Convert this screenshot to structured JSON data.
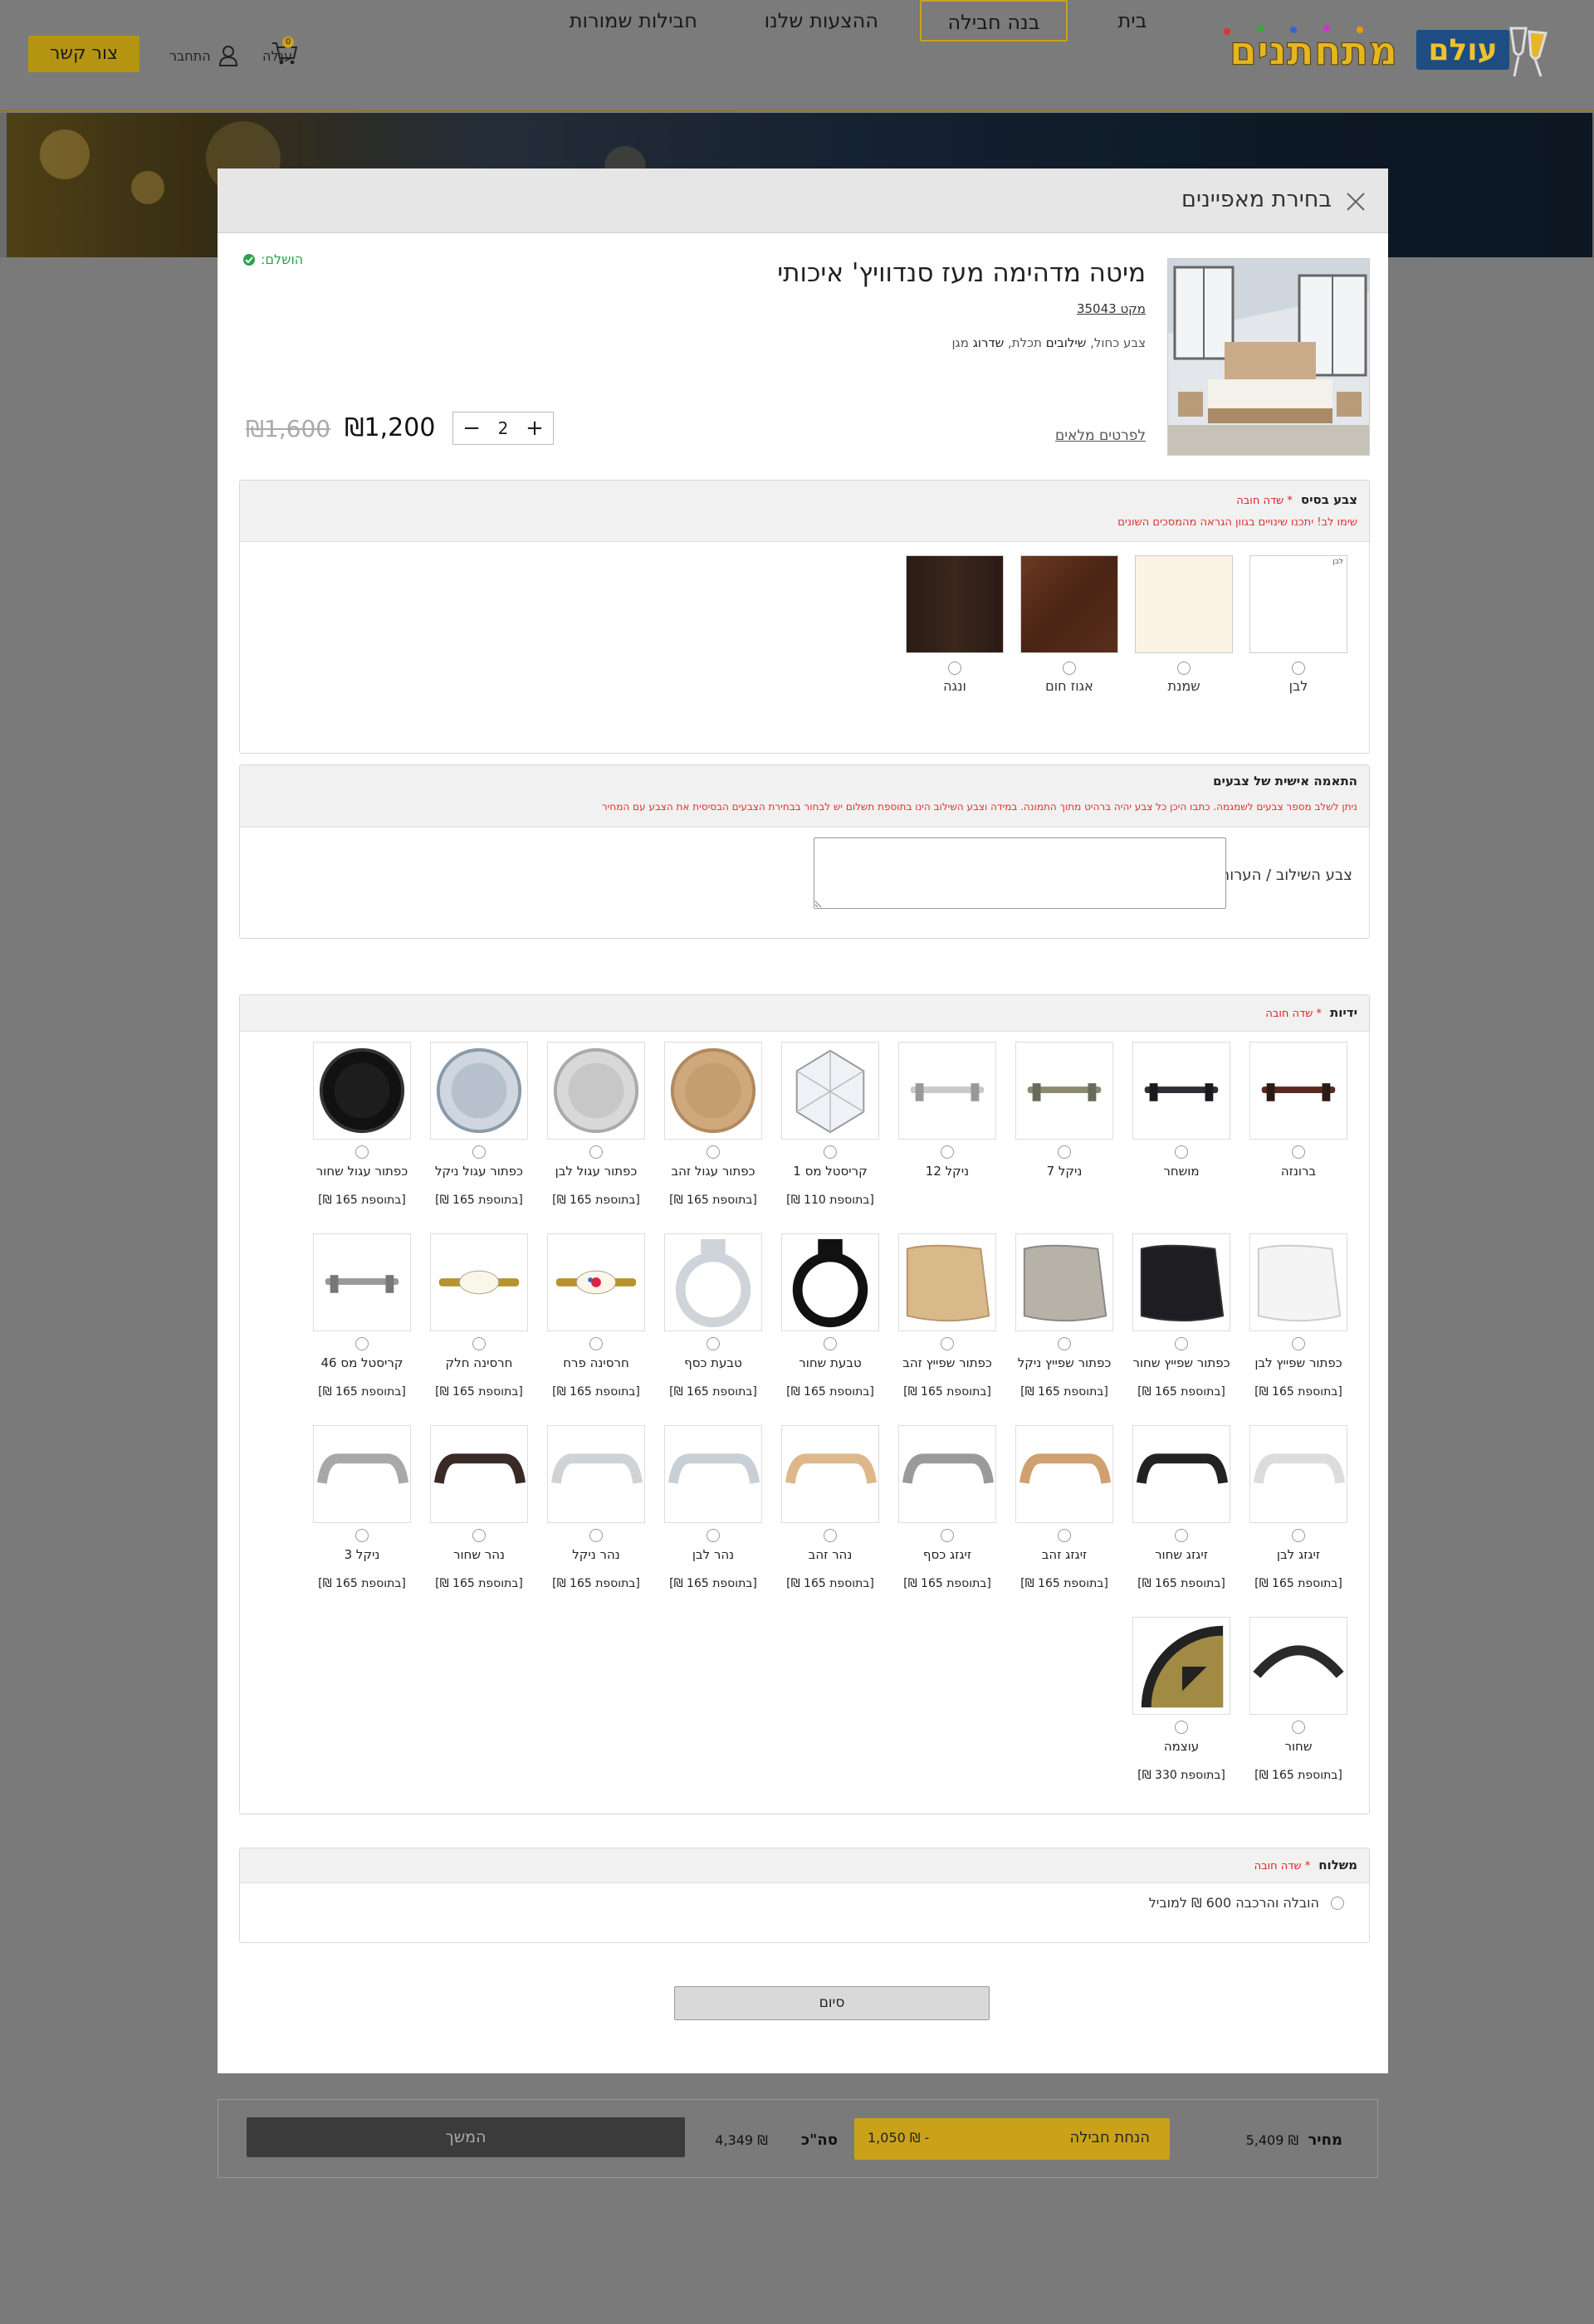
{
  "header": {
    "logo_text": "עולם מתחתנים",
    "nav": [
      "בית",
      "בנה חבילה",
      "ההצעות שלנו",
      "חבילות שמורות"
    ],
    "cart_label": "עגלה",
    "cart_count": "0",
    "login_label": "התחבר",
    "contact_button": "צור קשר"
  },
  "modal": {
    "title": "בחירת מאפיינים",
    "product": {
      "name": "מיטה מדהימה מעז סנדוויץ' איכותי",
      "sku": "מקט 35043",
      "attributes": {
        "prefix": "צבע",
        "items": [
          {
            "text": "כחול",
            "bold": false
          },
          {
            "text": "שילובים",
            "bold": true
          },
          {
            "text": "תכלת",
            "bold": false
          },
          {
            "text": "שדרוג",
            "bold": true
          },
          {
            "text": "מגן",
            "bold": false
          }
        ]
      },
      "completed_label": "הושלם:",
      "details_link": "לפרטים מלאים",
      "quantity": "2",
      "price": "₪1,200",
      "old_price": "₪1,600"
    },
    "base_color": {
      "title": "צבע בסיס",
      "required": "* שדה חובה",
      "note": "שימו לב! יתכנו שינויים בגוון הגראה מהמסכים השונים",
      "options": [
        {
          "name": "לבן",
          "color": "#ffffff",
          "tag": "לבן"
        },
        {
          "name": "שמנת",
          "color": "#fbf3e4"
        },
        {
          "name": "אגוז חום",
          "color": "#5a2e1c"
        },
        {
          "name": "ונגה",
          "color": "#2e1f18"
        }
      ]
    },
    "custom_colors": {
      "title": "התאמה אישית של צבעים",
      "note": "ניתן לשלב מספר צבעים לשמגמה. כתבו היכן כל צבע יהיה ברהיט מתוך התמונה.     במידה וצבע השילוב הינו בתוספת תשלום יש לבחור בבחירת הצבעים הבסיסית את הצבע עם המחיר",
      "field_label": "צבע השילוב / הערות"
    },
    "handles": {
      "title": "ידיות",
      "required": "* שדה חובה",
      "items": [
        {
          "name": "ברונזה",
          "addon": "",
          "icon": "bar-bronze"
        },
        {
          "name": "מושחר",
          "addon": "",
          "icon": "bar-dark"
        },
        {
          "name": "ניקל 7",
          "addon": "",
          "icon": "bar-nickel"
        },
        {
          "name": "ניקל 12",
          "addon": "",
          "icon": "bar-silver"
        },
        {
          "name": "קריסטל מס 1",
          "addon": "[בתוספת 110 ₪]",
          "icon": "crystal"
        },
        {
          "name": "כפתור עגול זהב",
          "addon": "[בתוספת 165 ₪]",
          "icon": "knob-gold"
        },
        {
          "name": "כפתור עגול לבן",
          "addon": "[בתוספת 165 ₪]",
          "icon": "knob-white"
        },
        {
          "name": "כפתור עגול ניקל",
          "addon": "[בתוספת 165 ₪]",
          "icon": "knob-nickel"
        },
        {
          "name": "כפתור עגול שחור",
          "addon": "[בתוספת 165 ₪]",
          "icon": "knob-black"
        },
        {
          "name": "כפתור שפייץ לבן",
          "addon": "[בתוספת 165 ₪]",
          "icon": "cone-white"
        },
        {
          "name": "כפתור שפייץ שחור",
          "addon": "[בתוספת 165 ₪]",
          "icon": "cone-black"
        },
        {
          "name": "כפתור שפייץ ניקל",
          "addon": "[בתוספת 165 ₪]",
          "icon": "cone-nickel"
        },
        {
          "name": "כפתור שפייץ זהב",
          "addon": "[בתוספת 165 ₪]",
          "icon": "cone-gold"
        },
        {
          "name": "טבעת שחור",
          "addon": "[בתוספת 165 ₪]",
          "icon": "ring-black"
        },
        {
          "name": "טבעת כסף",
          "addon": "[בתוספת 165 ₪]",
          "icon": "ring-silver"
        },
        {
          "name": "חרסינה פרח",
          "addon": "[בתוספת 165 ₪]",
          "icon": "porcelain-flower"
        },
        {
          "name": "חרסינה חלק",
          "addon": "[בתוספת 165 ₪]",
          "icon": "porcelain-plain"
        },
        {
          "name": "קריסטל מס 46",
          "addon": "[בתוספת 165 ₪]",
          "icon": "bar-crystal"
        },
        {
          "name": "זיגזג לבן",
          "addon": "[בתוספת 165 ₪]",
          "icon": "arch-white"
        },
        {
          "name": "זיגזג שחור",
          "addon": "[בתוספת 165 ₪]",
          "icon": "arch-black"
        },
        {
          "name": "זיגזג זהב",
          "addon": "[בתוספת 165 ₪]",
          "icon": "arch-gold"
        },
        {
          "name": "זיגזג כסף",
          "addon": "[בתוספת 165 ₪]",
          "icon": "arch-silver"
        },
        {
          "name": "נהר זהב",
          "addon": "[בתוספת 165 ₪]",
          "icon": "arch-gold2"
        },
        {
          "name": "נהר לבן",
          "addon": "[בתוספת 165 ₪]",
          "icon": "arch-white2"
        },
        {
          "name": "נהר ניקל",
          "addon": "[בתוספת 165 ₪]",
          "icon": "arch-nickel"
        },
        {
          "name": "נהר שחור",
          "addon": "[בתוספת 165 ₪]",
          "icon": "arch-black2"
        },
        {
          "name": "ניקל 3",
          "addon": "[בתוספת 165 ₪]",
          "icon": "arch-nickel2"
        },
        {
          "name": "שחור",
          "addon": "[בתוספת 165 ₪]",
          "icon": "curve-black"
        },
        {
          "name": "עוצמה",
          "addon": "[בתוספת 330 ₪]",
          "icon": "medallion"
        }
      ]
    },
    "shipping": {
      "title": "משלוח",
      "required": "* שדה חובה",
      "option": "הובלה והרכבה 600 ₪ למוביל"
    },
    "finish_button": "סיום"
  },
  "footer": {
    "price_label": "מחיר",
    "price_value": "₪ 5,409",
    "gift_label": "הנחת חבילה",
    "gift_value": "- ₪ 1,050",
    "total_label": "סה\"כ",
    "total_value": "₪ 4,349",
    "continue_button": "המשך"
  },
  "colors": {
    "accent": "#c9a21a",
    "required": "#e02020",
    "success": "#2aa34a"
  }
}
